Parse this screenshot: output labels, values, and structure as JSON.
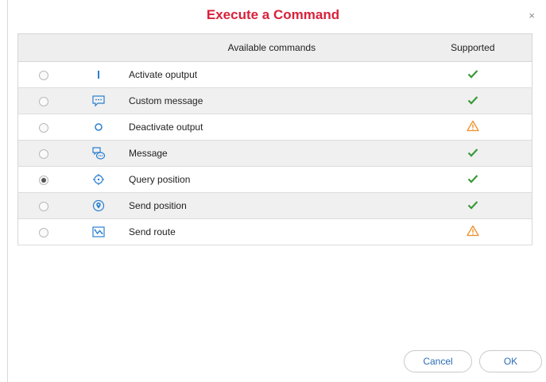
{
  "dialog": {
    "title": "Execute a Command",
    "close_glyph": "×"
  },
  "table": {
    "headers": {
      "commands": "Available commands",
      "supported": "Supported"
    },
    "rows": [
      {
        "label": "Activate oputput",
        "icon": "output-bar-icon",
        "selected": false,
        "supported": "check"
      },
      {
        "label": "Custom message",
        "icon": "speech-bubble-icon",
        "selected": false,
        "supported": "check"
      },
      {
        "label": "Deactivate output",
        "icon": "circle-outline-icon",
        "selected": false,
        "supported": "warning"
      },
      {
        "label": "Message",
        "icon": "chat-bubbles-icon",
        "selected": false,
        "supported": "check"
      },
      {
        "label": "Query position",
        "icon": "crosshair-icon",
        "selected": true,
        "supported": "check"
      },
      {
        "label": "Send position",
        "icon": "map-pin-icon",
        "selected": false,
        "supported": "check"
      },
      {
        "label": "Send route",
        "icon": "route-map-icon",
        "selected": false,
        "supported": "warning"
      }
    ]
  },
  "buttons": {
    "cancel": "Cancel",
    "ok": "OK"
  },
  "colors": {
    "title": "#d8213b",
    "check": "#3a9a3a",
    "warning": "#f0902a",
    "icon": "#2a7fd0",
    "button_text": "#2a6cb5"
  }
}
